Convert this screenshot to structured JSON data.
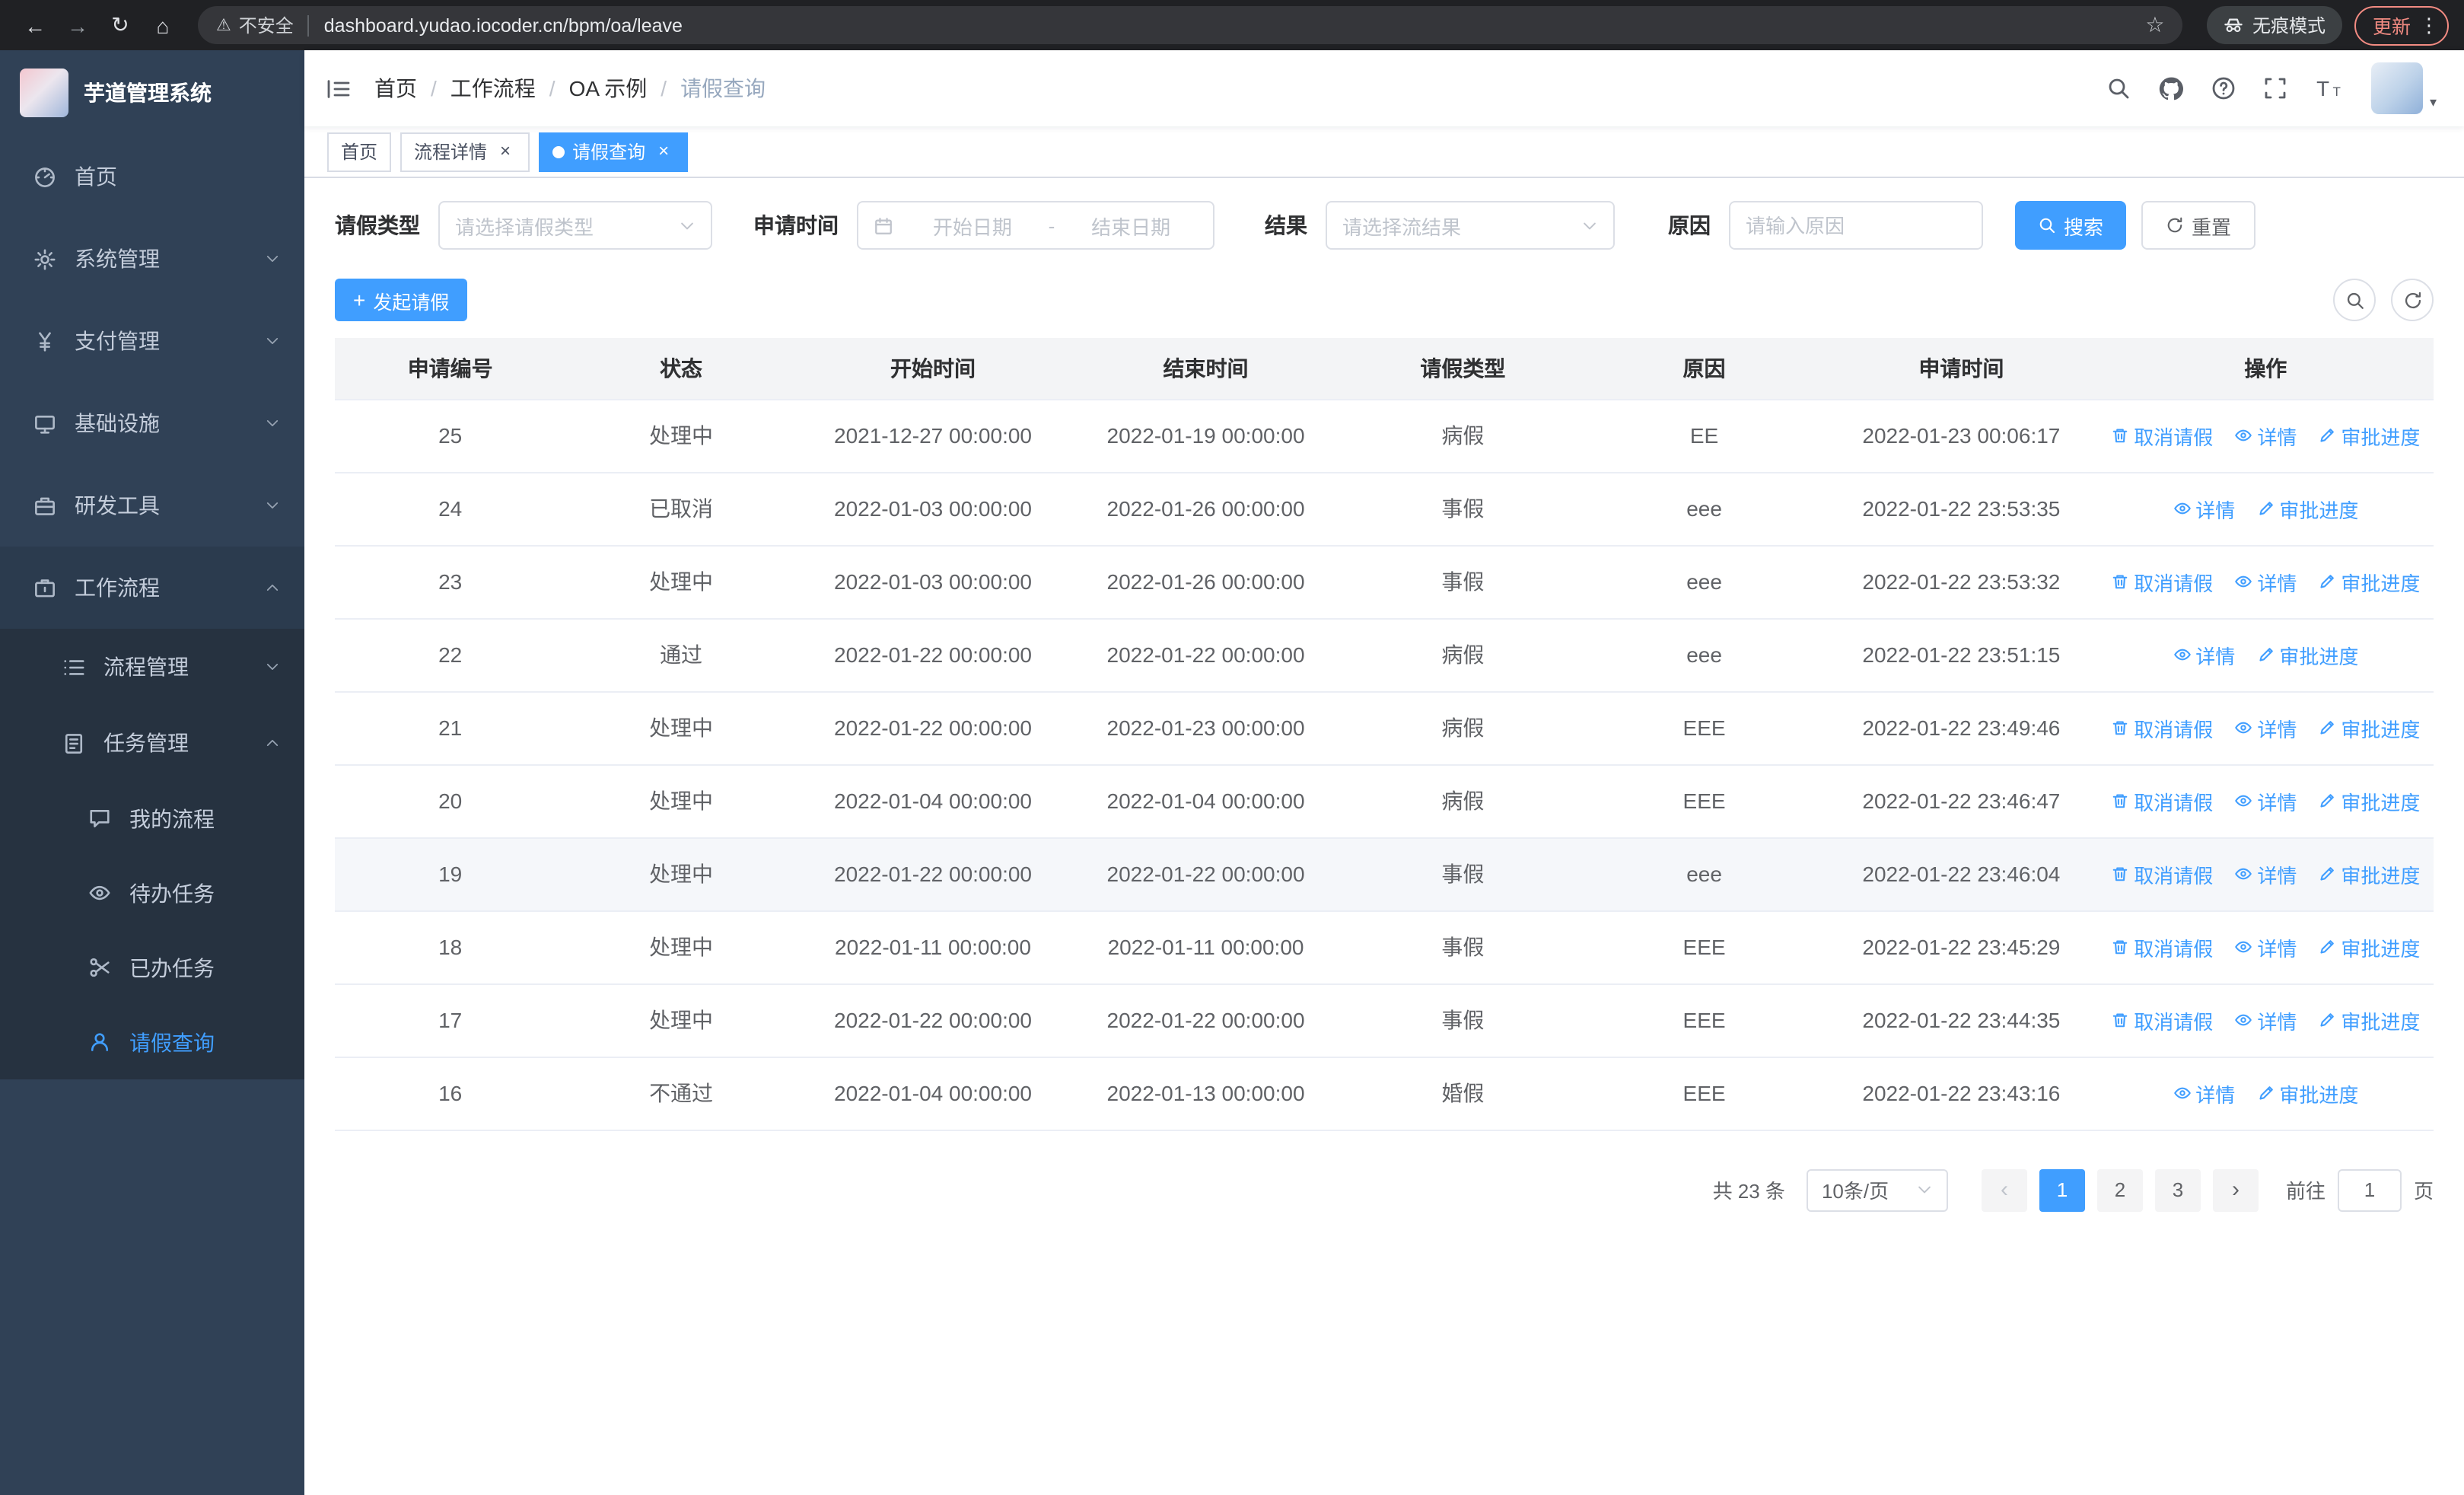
{
  "browser": {
    "security_warning": "不安全",
    "url": "dashboard.yudao.iocoder.cn/bpm/oa/leave",
    "incognito_label": "无痕模式",
    "update_label": "更新"
  },
  "sidebar": {
    "logo_title": "芋道管理系统",
    "items": [
      {
        "label": "首页",
        "icon": "dashboard-icon",
        "icon_key": "dashboard",
        "level": 1,
        "chevron": null,
        "expanded": false,
        "active": false,
        "sub": false
      },
      {
        "label": "系统管理",
        "icon": "gear-icon",
        "icon_key": "gear",
        "level": 1,
        "chevron": "down",
        "expanded": false,
        "active": false,
        "sub": false
      },
      {
        "label": "支付管理",
        "icon": "yen-icon",
        "icon_key": "yen",
        "level": 1,
        "chevron": "down",
        "expanded": false,
        "active": false,
        "sub": false
      },
      {
        "label": "基础设施",
        "icon": "monitor-icon",
        "icon_key": "infra",
        "level": 1,
        "chevron": "down",
        "expanded": false,
        "active": false,
        "sub": false
      },
      {
        "label": "研发工具",
        "icon": "toolbox-icon",
        "icon_key": "tools",
        "level": 1,
        "chevron": "down",
        "expanded": false,
        "active": false,
        "sub": false
      },
      {
        "label": "工作流程",
        "icon": "briefcase-icon",
        "icon_key": "workflow",
        "level": 1,
        "chevron": "up",
        "expanded": true,
        "active": false,
        "sub": false
      },
      {
        "label": "流程管理",
        "icon": "list-icon",
        "icon_key": "process",
        "level": 2,
        "chevron": "down",
        "expanded": false,
        "active": false,
        "sub": true
      },
      {
        "label": "任务管理",
        "icon": "tasks-icon",
        "icon_key": "tasks",
        "level": 2,
        "chevron": "up",
        "expanded": true,
        "active": false,
        "sub": true
      },
      {
        "label": "我的流程",
        "icon": "chat-bubble-icon",
        "icon_key": "chat",
        "level": 3,
        "chevron": null,
        "expanded": false,
        "active": false,
        "sub": true
      },
      {
        "label": "待办任务",
        "icon": "eye-icon",
        "icon_key": "eye",
        "level": 3,
        "chevron": null,
        "expanded": false,
        "active": false,
        "sub": true
      },
      {
        "label": "已办任务",
        "icon": "scissors-icon",
        "icon_key": "scissors",
        "level": 3,
        "chevron": null,
        "expanded": false,
        "active": false,
        "sub": true
      },
      {
        "label": "请假查询",
        "icon": "user-icon",
        "icon_key": "user",
        "level": 3,
        "chevron": null,
        "expanded": false,
        "active": true,
        "sub": true
      }
    ]
  },
  "header": {
    "breadcrumb": [
      "首页",
      "工作流程",
      "OA 示例",
      "请假查询"
    ],
    "breadcrumb_separator": "/",
    "icons": [
      {
        "name": "search-icon",
        "key": "search"
      },
      {
        "name": "github-icon",
        "key": "github"
      },
      {
        "name": "help-icon",
        "key": "question"
      },
      {
        "name": "fullscreen-icon",
        "key": "fullscreen"
      },
      {
        "name": "font-size-icon",
        "key": "fontsize"
      }
    ]
  },
  "tabs": [
    {
      "label": "首页",
      "closable": false,
      "active": false
    },
    {
      "label": "流程详情",
      "closable": true,
      "active": false
    },
    {
      "label": "请假查询",
      "closable": true,
      "active": true
    }
  ],
  "filters": {
    "leave_type_label": "请假类型",
    "leave_type_placeholder": "请选择请假类型",
    "apply_time_label": "申请时间",
    "start_date_placeholder": "开始日期",
    "range_separator": "-",
    "end_date_placeholder": "结束日期",
    "result_label": "结果",
    "result_placeholder": "请选择流结果",
    "reason_label": "原因",
    "reason_placeholder": "请输入原因",
    "search_label": "搜索",
    "reset_label": "重置"
  },
  "toolbar": {
    "create_label": "发起请假"
  },
  "table": {
    "columns": [
      "申请编号",
      "状态",
      "开始时间",
      "结束时间",
      "请假类型",
      "原因",
      "申请时间",
      "操作"
    ],
    "action_defs": {
      "cancel": {
        "label": "取消请假",
        "icon": "trash-icon",
        "icon_key": "trash"
      },
      "detail": {
        "label": "详情",
        "icon": "eye-icon",
        "icon_key": "eye"
      },
      "progress": {
        "label": "审批进度",
        "icon": "pen-icon",
        "icon_key": "pen"
      }
    },
    "rows": [
      {
        "id": "25",
        "status": "处理中",
        "start": "2021-12-27 00:00:00",
        "end": "2022-01-19 00:00:00",
        "type": "病假",
        "reason": "EE",
        "apply_time": "2022-01-23 00:06:17",
        "actions": [
          "cancel",
          "detail",
          "progress"
        ],
        "highlighted": false
      },
      {
        "id": "24",
        "status": "已取消",
        "start": "2022-01-03 00:00:00",
        "end": "2022-01-26 00:00:00",
        "type": "事假",
        "reason": "eee",
        "apply_time": "2022-01-22 23:53:35",
        "actions": [
          "detail",
          "progress"
        ],
        "highlighted": false
      },
      {
        "id": "23",
        "status": "处理中",
        "start": "2022-01-03 00:00:00",
        "end": "2022-01-26 00:00:00",
        "type": "事假",
        "reason": "eee",
        "apply_time": "2022-01-22 23:53:32",
        "actions": [
          "cancel",
          "detail",
          "progress"
        ],
        "highlighted": false
      },
      {
        "id": "22",
        "status": "通过",
        "start": "2022-01-22 00:00:00",
        "end": "2022-01-22 00:00:00",
        "type": "病假",
        "reason": "eee",
        "apply_time": "2022-01-22 23:51:15",
        "actions": [
          "detail",
          "progress"
        ],
        "highlighted": false
      },
      {
        "id": "21",
        "status": "处理中",
        "start": "2022-01-22 00:00:00",
        "end": "2022-01-23 00:00:00",
        "type": "病假",
        "reason": "EEE",
        "apply_time": "2022-01-22 23:49:46",
        "actions": [
          "cancel",
          "detail",
          "progress"
        ],
        "highlighted": false
      },
      {
        "id": "20",
        "status": "处理中",
        "start": "2022-01-04 00:00:00",
        "end": "2022-01-04 00:00:00",
        "type": "病假",
        "reason": "EEE",
        "apply_time": "2022-01-22 23:46:47",
        "actions": [
          "cancel",
          "detail",
          "progress"
        ],
        "highlighted": false
      },
      {
        "id": "19",
        "status": "处理中",
        "start": "2022-01-22 00:00:00",
        "end": "2022-01-22 00:00:00",
        "type": "事假",
        "reason": "eee",
        "apply_time": "2022-01-22 23:46:04",
        "actions": [
          "cancel",
          "detail",
          "progress"
        ],
        "highlighted": true
      },
      {
        "id": "18",
        "status": "处理中",
        "start": "2022-01-11 00:00:00",
        "end": "2022-01-11 00:00:00",
        "type": "事假",
        "reason": "EEE",
        "apply_time": "2022-01-22 23:45:29",
        "actions": [
          "cancel",
          "detail",
          "progress"
        ],
        "highlighted": false
      },
      {
        "id": "17",
        "status": "处理中",
        "start": "2022-01-22 00:00:00",
        "end": "2022-01-22 00:00:00",
        "type": "事假",
        "reason": "EEE",
        "apply_time": "2022-01-22 23:44:35",
        "actions": [
          "cancel",
          "detail",
          "progress"
        ],
        "highlighted": false
      },
      {
        "id": "16",
        "status": "不通过",
        "start": "2022-01-04 00:00:00",
        "end": "2022-01-13 00:00:00",
        "type": "婚假",
        "reason": "EEE",
        "apply_time": "2022-01-22 23:43:16",
        "actions": [
          "detail",
          "progress"
        ],
        "highlighted": false
      }
    ]
  },
  "pagination": {
    "total_text": "共 23 条",
    "page_size_text": "10条/页",
    "pages": [
      "1",
      "2",
      "3"
    ],
    "active_page": "1",
    "goto_prefix": "前往",
    "goto_value": "1",
    "goto_suffix": "页"
  },
  "colors": {
    "primary": "#409EFF",
    "sidebar_bg": "#304156",
    "tab_active_bg": "#409EFF"
  }
}
